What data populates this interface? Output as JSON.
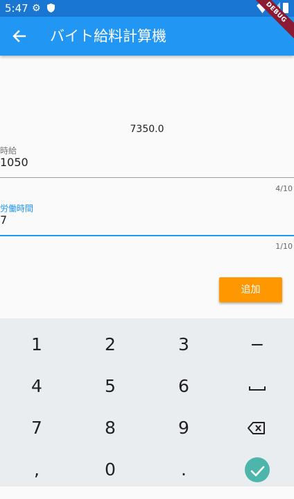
{
  "status_bar": {
    "time": "5:47"
  },
  "app_bar": {
    "title": "バイト給料計算機"
  },
  "debug_banner": "DEBUG",
  "result": "7350.0",
  "fields": {
    "hourly_wage": {
      "label": "時給",
      "value": "1050",
      "counter": "4/10"
    },
    "work_hours": {
      "label": "労働時間",
      "value": "7",
      "counter": "1/10"
    }
  },
  "add_button": {
    "label": "追加"
  },
  "keyboard": {
    "rows": [
      [
        "1",
        "2",
        "3",
        "−"
      ],
      [
        "4",
        "5",
        "6",
        "space"
      ],
      [
        "7",
        "8",
        "9",
        "backspace"
      ],
      [
        ",",
        "0",
        ".",
        "done"
      ]
    ]
  },
  "colors": {
    "status_bar": "#1976d2",
    "app_bar": "#2196f3",
    "focus": "#2196f3",
    "button": "#ff9800",
    "keyboard_bg": "#e9edf0",
    "done_key": "#4db6ac"
  }
}
